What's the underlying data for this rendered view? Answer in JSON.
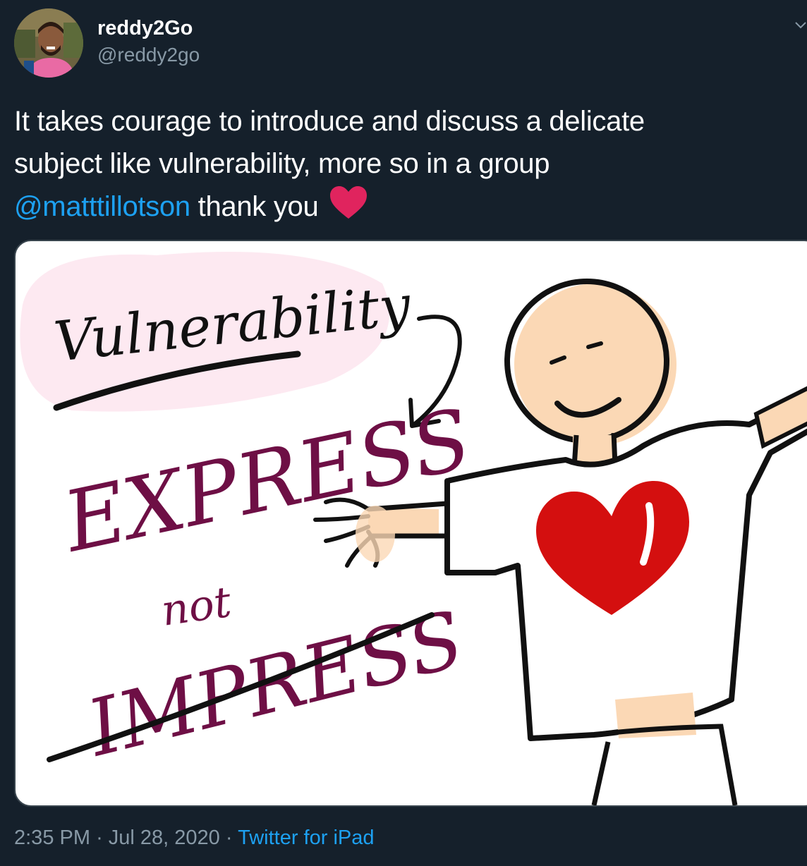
{
  "author": {
    "display_name": "reddy2Go",
    "handle": "@reddy2go"
  },
  "tweet": {
    "text_line1": "It takes courage to introduce and discuss a delicate",
    "text_line2": "subject like vulnerability, more so in a group",
    "mention": "@matttillotson",
    "text_after_mention": "thank you",
    "emoji": "heart-emoji"
  },
  "media": {
    "title": "Vulnerability",
    "word_express": "EXPRESS",
    "word_not": "not",
    "word_impress": "IMPRESS",
    "heart_color": "#d40f0f",
    "ink_color": "#6e0f45"
  },
  "meta": {
    "time": "2:35 PM",
    "separator": "·",
    "date": "Jul 28, 2020",
    "source": "Twitter for iPad"
  },
  "colors": {
    "background": "#15202b",
    "link": "#1da1f2",
    "secondary_text": "#8899a6"
  }
}
